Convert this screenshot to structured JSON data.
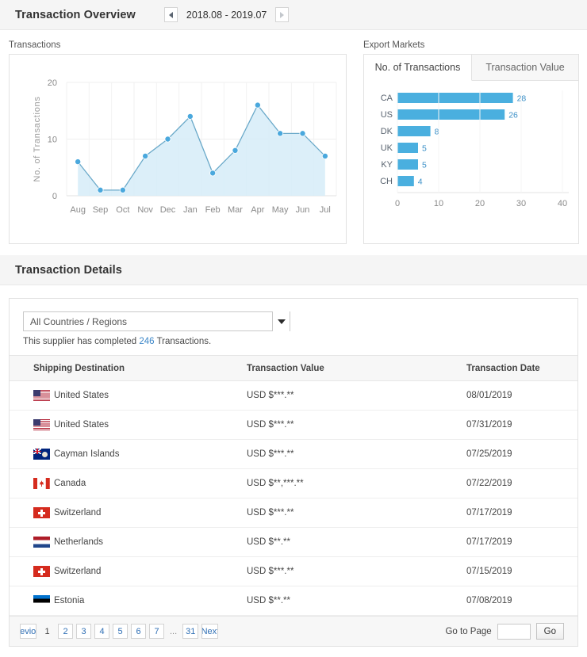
{
  "overview": {
    "title": "Transaction Overview",
    "date_range": "2018.08 - 2019.07",
    "prev_label": "◀",
    "next_label": "▶"
  },
  "transactions_chart": {
    "caption": "Transactions"
  },
  "export_markets": {
    "caption": "Export Markets",
    "tabs": [
      {
        "label": "No. of Transactions",
        "active": true
      },
      {
        "label": "Transaction Value",
        "active": false
      }
    ]
  },
  "details": {
    "title": "Transaction Details",
    "filter": {
      "selected": "All Countries / Regions",
      "placeholder": "All Countries / Regions"
    },
    "note_prefix": "This supplier has completed ",
    "note_count": "246",
    "note_suffix": " Transactions.",
    "columns": [
      "Shipping Destination",
      "Transaction Value",
      "Transaction Date"
    ],
    "rows": [
      {
        "flag": "flag-us",
        "destination": "United States",
        "value": "USD $***.**",
        "date": "08/01/2019"
      },
      {
        "flag": "flag-us",
        "destination": "United States",
        "value": "USD $***.**",
        "date": "07/31/2019"
      },
      {
        "flag": "flag-ky",
        "destination": "Cayman Islands",
        "value": "USD $***.**",
        "date": "07/25/2019"
      },
      {
        "flag": "flag-ca",
        "destination": "Canada",
        "value": "USD $**,***.**",
        "date": "07/22/2019"
      },
      {
        "flag": "flag-ch",
        "destination": "Switzerland",
        "value": "USD $***.**",
        "date": "07/17/2019"
      },
      {
        "flag": "flag-nl",
        "destination": "Netherlands",
        "value": "USD $**.**",
        "date": "07/17/2019"
      },
      {
        "flag": "flag-ch",
        "destination": "Switzerland",
        "value": "USD $***.**",
        "date": "07/15/2019"
      },
      {
        "flag": "flag-ee",
        "destination": "Estonia",
        "value": "USD $**.**",
        "date": "07/08/2019"
      }
    ]
  },
  "pagination": {
    "first_label": "Previous",
    "pages": [
      "1",
      "2",
      "3",
      "4",
      "5",
      "6",
      "7"
    ],
    "current_page": "1",
    "ellipsis": "...",
    "last_page": "31",
    "last_label": "Next",
    "goto_label": "Go to Page",
    "goto_value": "",
    "go_button": "Go"
  },
  "colors": {
    "accent": "#4aa8dd",
    "accent_fill": "#d6ecf8",
    "link": "#3b86c8",
    "bar": "#4aafdf",
    "header_bg": "#f5f5f5"
  },
  "chart_data": [
    {
      "type": "line",
      "title": "Transactions",
      "xlabel": "",
      "ylabel": "No. of Transactions",
      "categories": [
        "Aug",
        "Sep",
        "Oct",
        "Nov",
        "Dec",
        "Jan",
        "Feb",
        "Mar",
        "Apr",
        "May",
        "Jun",
        "Jul"
      ],
      "values": [
        6,
        1,
        1,
        7,
        10,
        14,
        4,
        8,
        16,
        11,
        11,
        7
      ],
      "yticks": [
        0,
        10,
        20
      ],
      "ylim": [
        0,
        20
      ],
      "grid": true,
      "area": true,
      "legend": "none"
    },
    {
      "type": "bar",
      "orientation": "horizontal",
      "title": "Export Markets",
      "subtitle": "No. of Transactions",
      "xlabel": "",
      "ylabel": "",
      "categories": [
        "CA",
        "US",
        "DK",
        "UK",
        "KY",
        "CH"
      ],
      "values": [
        28,
        26,
        8,
        5,
        5,
        4
      ],
      "xticks": [
        0,
        10,
        20,
        30,
        40
      ],
      "xlim": [
        0,
        40
      ],
      "data_labels": [
        "28",
        "26",
        "8",
        "5",
        "5",
        "4"
      ],
      "grid": false,
      "legend": "none"
    }
  ]
}
